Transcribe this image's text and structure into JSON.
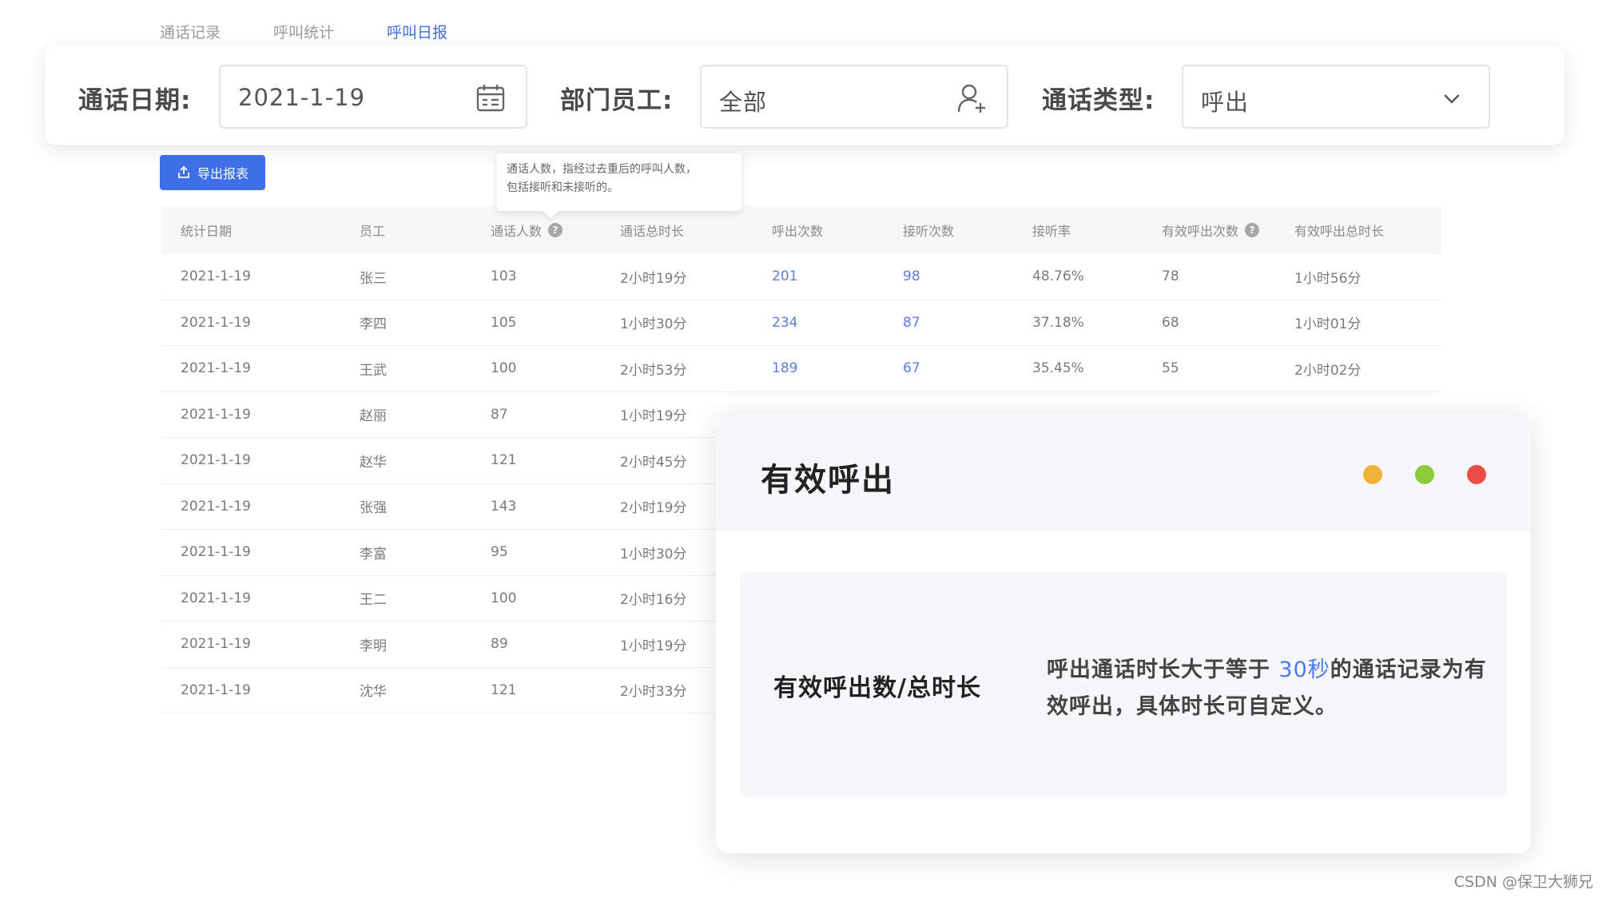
{
  "tabs": [
    {
      "label": "通话记录"
    },
    {
      "label": "呼叫统计"
    },
    {
      "label": "呼叫日报"
    }
  ],
  "filters": {
    "date_label": "通话日期:",
    "date_value": "2021-1-19",
    "dept_label": "部门员工:",
    "dept_value": "全部",
    "type_label": "通话类型:",
    "type_value": "呼出"
  },
  "export_label": "导出报表",
  "tooltip": {
    "line1": "通话人数，指经过去重后的呼叫人数，",
    "line2": "包括接听和未接听的。"
  },
  "table": {
    "headers": [
      "统计日期",
      "员工",
      "通话人数",
      "通话总时长",
      "呼出次数",
      "接听次数",
      "接听率",
      "有效呼出次数",
      "有效呼出总时长"
    ],
    "rows": [
      [
        "2021-1-19",
        "张三",
        "103",
        "2小时19分",
        "201",
        "98",
        "48.76%",
        "78",
        "1小时56分"
      ],
      [
        "2021-1-19",
        "李四",
        "105",
        "1小时30分",
        "234",
        "87",
        "37.18%",
        "68",
        "1小时01分"
      ],
      [
        "2021-1-19",
        "王武",
        "100",
        "2小时53分",
        "189",
        "67",
        "35.45%",
        "55",
        "2小时02分"
      ],
      [
        "2021-1-19",
        "赵丽",
        "87",
        "1小时19分",
        "",
        "",
        "",
        "",
        ""
      ],
      [
        "2021-1-19",
        "赵华",
        "121",
        "2小时45分",
        "",
        "",
        "",
        "",
        ""
      ],
      [
        "2021-1-19",
        "张强",
        "143",
        "2小时19分",
        "",
        "",
        "",
        "",
        ""
      ],
      [
        "2021-1-19",
        "李富",
        "95",
        "1小时30分",
        "",
        "",
        "",
        "",
        ""
      ],
      [
        "2021-1-19",
        "王二",
        "100",
        "2小时16分",
        "",
        "",
        "",
        "",
        ""
      ],
      [
        "2021-1-19",
        "李明",
        "89",
        "1小时19分",
        "",
        "",
        "",
        "",
        ""
      ],
      [
        "2021-1-19",
        "沈华",
        "121",
        "2小时33分",
        "",
        "",
        "",
        "",
        ""
      ]
    ]
  },
  "popup": {
    "title": "有效呼出",
    "dot_colors": [
      "#f0b33a",
      "#8ccd3c",
      "#ec4b45"
    ],
    "body_label": "有效呼出数/总时长",
    "desc_before": "呼出通话时长大于等于 ",
    "desc_highlight": "30秒",
    "desc_after": "的通话记录为有效呼出，具体时长可自定义。"
  },
  "watermark": "CSDN @保卫大狮兄"
}
